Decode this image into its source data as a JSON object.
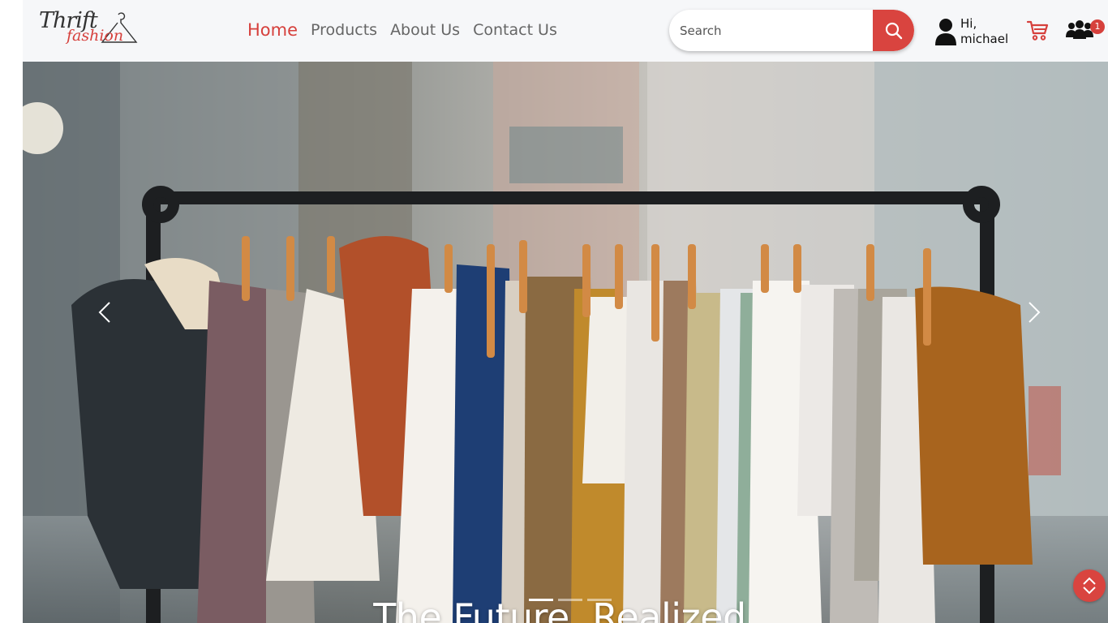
{
  "brand": {
    "line1": "Thrift",
    "line2": "fashion"
  },
  "nav": {
    "home": "Home",
    "products": "Products",
    "about": "About Us",
    "contact": "Contact Us"
  },
  "search": {
    "placeholder": "Search",
    "value": "",
    "button_icon": "search-icon"
  },
  "user": {
    "greeting_line1": "Hi,",
    "greeting_line2": "michael",
    "icon": "user-icon"
  },
  "cart": {
    "icon": "cart-icon"
  },
  "group": {
    "icon": "group-icon",
    "badge_count": "1"
  },
  "hero": {
    "caption": "The Future, Realized.",
    "image": "clothing-rack-photo",
    "slide_count": 3,
    "active_slide": 1,
    "prev_icon": "chevron-left-icon",
    "next_icon": "chevron-right-icon"
  },
  "scroll_top": {
    "icon": "chevrons-up-down-icon"
  },
  "colors": {
    "accent": "#d9443f",
    "nav_text": "#666666",
    "navbar_bg": "#f6f7f9"
  }
}
